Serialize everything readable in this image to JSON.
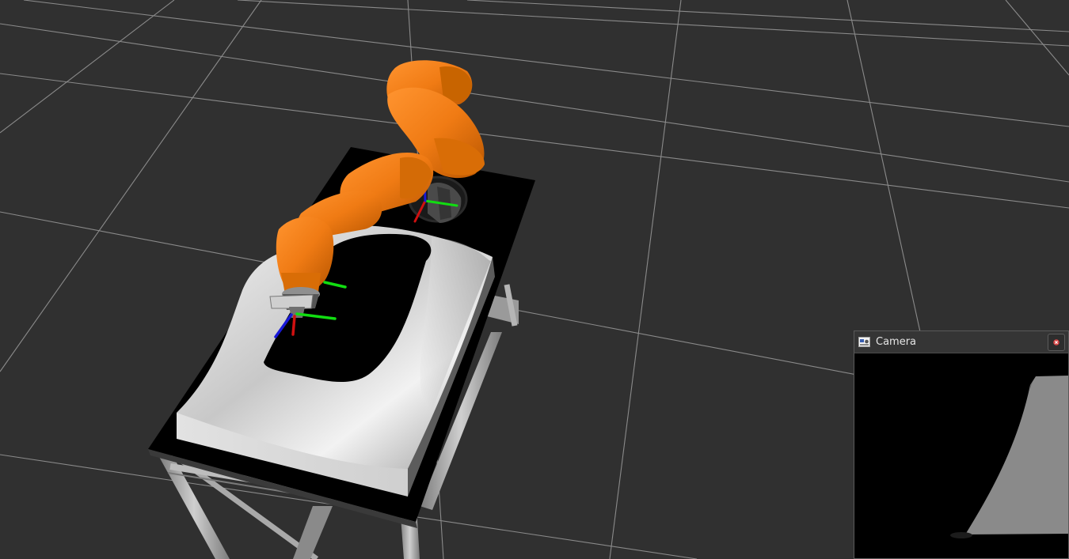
{
  "camera_panel": {
    "title": "Camera",
    "title_icon": "camera-display-icon",
    "close_icon": "close-icon"
  },
  "colors": {
    "background": "#303030",
    "grid": "#8a8a8a",
    "robot_orange": "#f07b14",
    "axis_x": "#d01010",
    "axis_y": "#11dd11",
    "axis_z": "#1818d8"
  }
}
